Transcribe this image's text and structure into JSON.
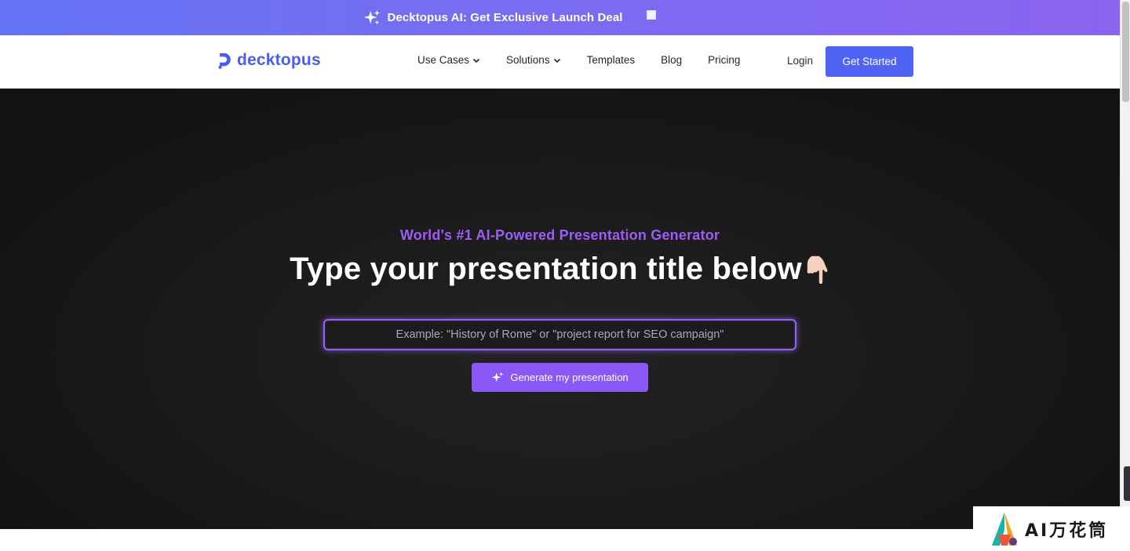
{
  "promo": {
    "text": "Decktopus AI: Get Exclusive Launch Deal",
    "image_alt": ""
  },
  "nav": {
    "logo_text": "decktopus",
    "items": [
      {
        "label": "Use Cases",
        "has_dropdown": true
      },
      {
        "label": "Solutions",
        "has_dropdown": true
      },
      {
        "label": "Templates",
        "has_dropdown": false
      },
      {
        "label": "Blog",
        "has_dropdown": false
      },
      {
        "label": "Pricing",
        "has_dropdown": false
      }
    ],
    "login_label": "Login",
    "cta_label": "Get Started"
  },
  "hero": {
    "eyebrow": "World's #1 AI-Powered Presentation Generator",
    "headline": "Type your presentation title below",
    "input_placeholder": "Example: \"History of Rome\" or \"project report for SEO campaign\"",
    "input_value": "",
    "generate_label": "Generate my presentation"
  },
  "watermark": {
    "text": "AI万花筒"
  },
  "colors": {
    "brand_blue": "#4f64f4",
    "accent_purple": "#8a58f6",
    "eyebrow_purple": "#9e5bf6",
    "hero_bg": "#1b1b1b"
  }
}
